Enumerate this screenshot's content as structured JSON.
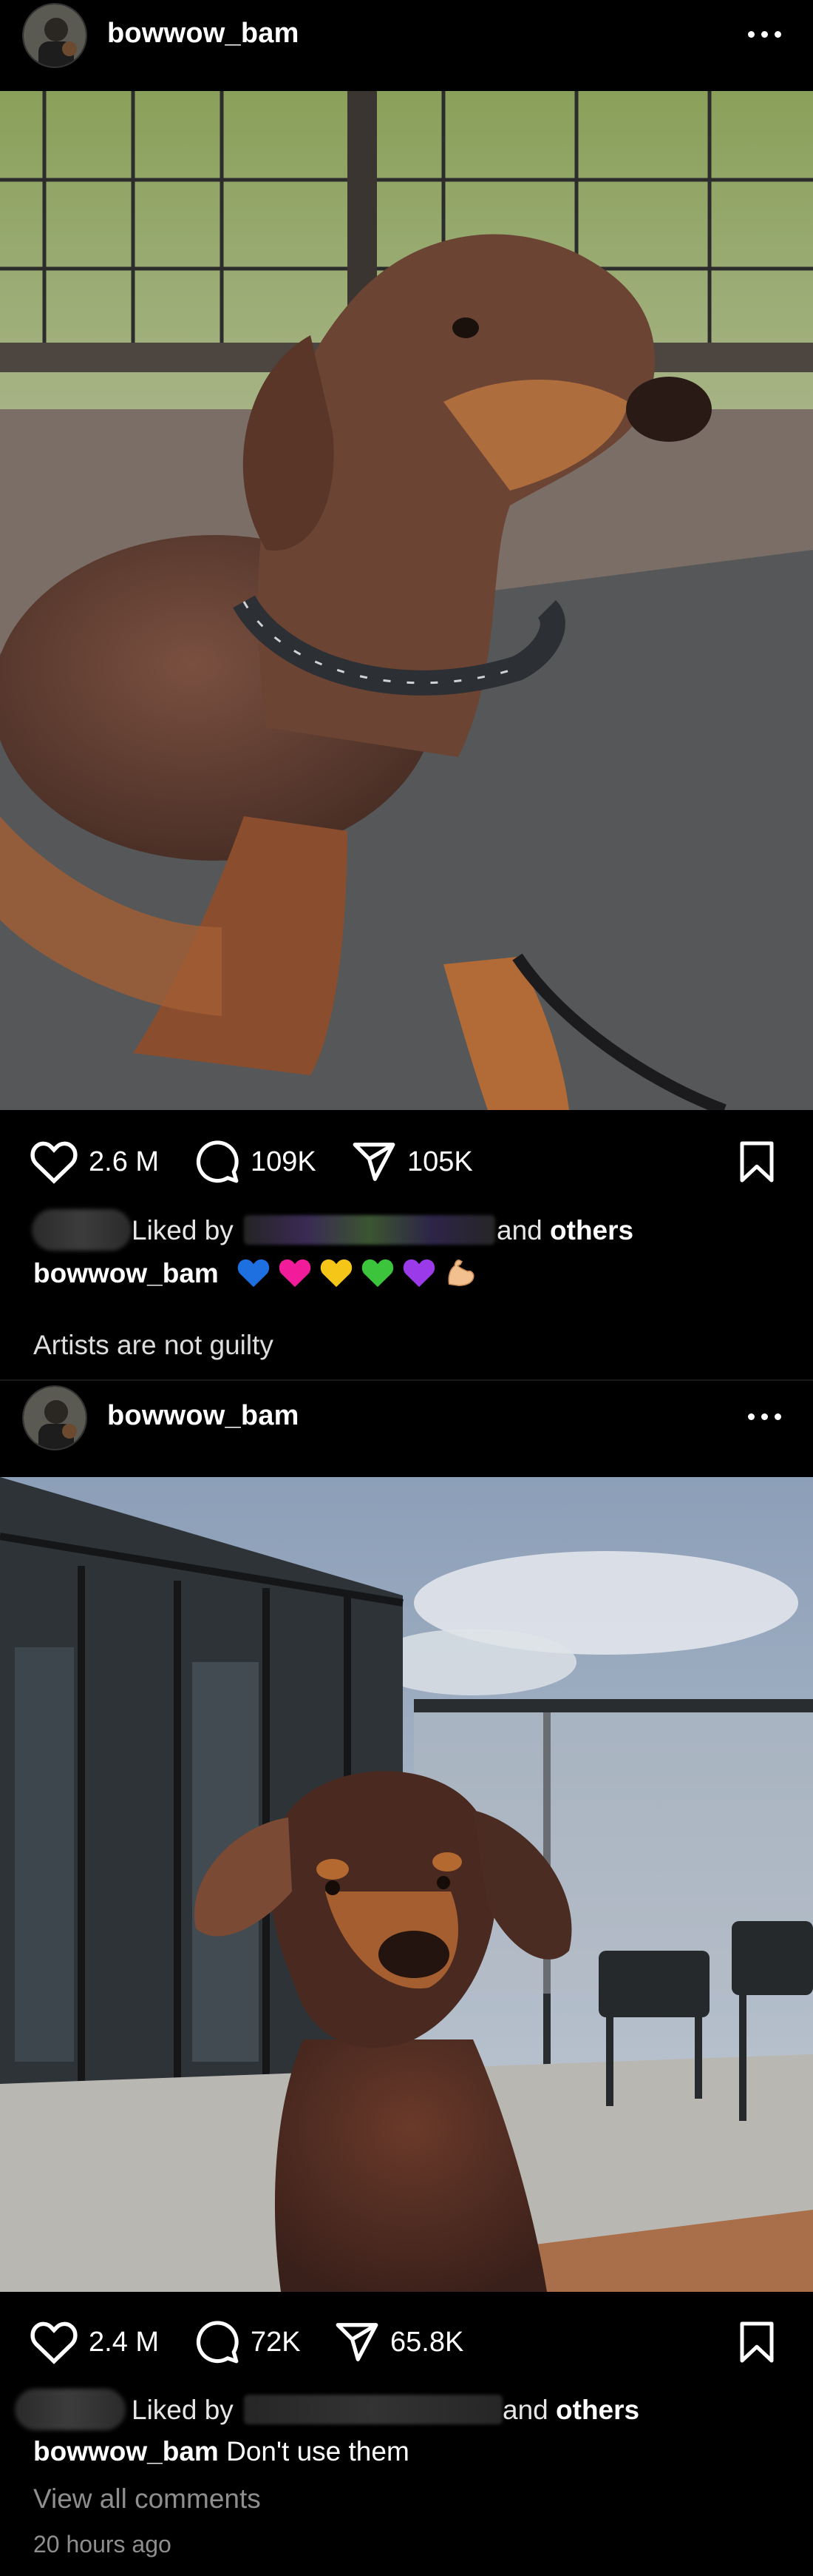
{
  "posts": [
    {
      "username": "bowwow_bam",
      "likes": "2.6 M",
      "comments": "109K",
      "shares": "105K",
      "liked_by": "Liked by",
      "and_text": "and",
      "others_text": "others",
      "caption_user": "bowwow_bam",
      "caption_emojis": [
        "blue-heart",
        "pink-heart",
        "yellow-heart",
        "green-heart",
        "purple-heart",
        "flexed-biceps"
      ],
      "caption_text": "Artists are not guilty"
    },
    {
      "username": "bowwow_bam",
      "likes": "2.4 M",
      "comments": "72K",
      "shares": "65.8K",
      "liked_by": "Liked by",
      "and_text": "and",
      "others_text": "others",
      "caption_user": "bowwow_bam",
      "caption_text": "Don't use them",
      "view_comments": "View all comments",
      "timestamp": "20 hours ago"
    }
  ],
  "colors": {
    "background": "#000000",
    "text": "#ffffff",
    "muted": "#8e8e8e",
    "blue_heart": "#1e6fe0",
    "pink_heart": "#f21b9a",
    "yellow_heart": "#f5c518",
    "green_heart": "#3cc43c",
    "purple_heart": "#9a3ae8"
  },
  "icons": [
    "heart-icon",
    "comment-icon",
    "share-icon",
    "bookmark-icon",
    "more-options-icon"
  ]
}
